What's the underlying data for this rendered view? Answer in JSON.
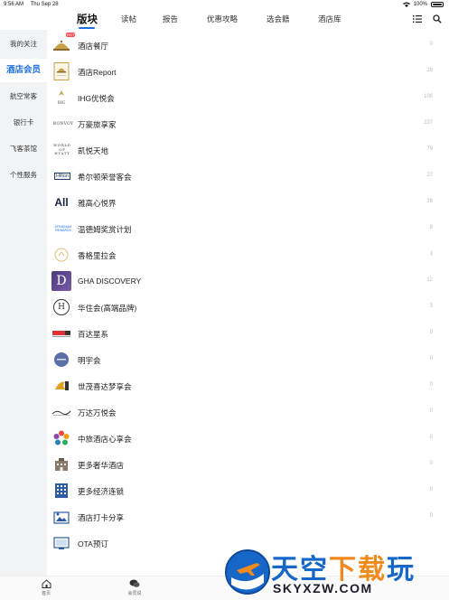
{
  "status": {
    "time": "9:56 AM",
    "date": "Thu Sep 28",
    "battery": "100%"
  },
  "nav": {
    "tabs": [
      "版块",
      "读帖",
      "报告",
      "优惠攻略",
      "选会籍",
      "酒店库"
    ],
    "active_tab": "版块"
  },
  "sidebar": {
    "items": [
      "我的关注",
      "酒店会员",
      "航空常客",
      "银行卡",
      "飞客茶馆",
      "个性服务"
    ],
    "active": "酒店会员"
  },
  "forums": [
    {
      "name": "酒店餐厅",
      "count": "0",
      "icon": "dining-cloche-icon",
      "badge": "HOT"
    },
    {
      "name": "酒店Report",
      "count": "29",
      "icon": "report-icon"
    },
    {
      "name": "IHG优悦会",
      "count": "106",
      "icon": "ihg-logo"
    },
    {
      "name": "万豪旅享家",
      "count": "237",
      "icon": "marriott-bonvoy-logo",
      "logo_text": "BONVOY"
    },
    {
      "name": "凯悦天地",
      "count": "79",
      "icon": "world-of-hyatt-logo",
      "logo_text": "WORLD OF HYATT"
    },
    {
      "name": "希尔顿荣誉客会",
      "count": "27",
      "icon": "hilton-logo",
      "logo_text": "Hilton"
    },
    {
      "name": "雅高心悦界",
      "count": "26",
      "icon": "accor-all-logo",
      "logo_text": "All"
    },
    {
      "name": "温德姆奖赏计划",
      "count": "8",
      "icon": "wyndham-rewards-logo",
      "logo_text": "WYNDHAM REWARDS"
    },
    {
      "name": "香格里拉会",
      "count": "1",
      "icon": "shangri-la-logo"
    },
    {
      "name": "GHA DISCOVERY",
      "count": "12",
      "icon": "gha-logo",
      "logo_text": "D"
    },
    {
      "name": "华住会(高端品牌)",
      "count": "3",
      "icon": "huazhu-logo",
      "logo_text": "H"
    },
    {
      "name": "百达星系",
      "count": "0",
      "icon": "bestay-logo"
    },
    {
      "name": "明宇会",
      "count": "0",
      "icon": "mingyu-logo"
    },
    {
      "name": "世茂喜达梦享会",
      "count": "0",
      "icon": "shimao-logo"
    },
    {
      "name": "万达万悦会",
      "count": "0",
      "icon": "wanda-logo"
    },
    {
      "name": "中旅酒店心享会",
      "count": "0",
      "icon": "ctg-flower-logo"
    },
    {
      "name": "更多奢华酒店",
      "count": "0",
      "icon": "luxury-hotel-icon"
    },
    {
      "name": "更多经济连锁",
      "count": "0",
      "icon": "budget-hotel-icon"
    },
    {
      "name": "酒店打卡分享",
      "count": "0",
      "icon": "checkin-share-icon"
    },
    {
      "name": "OTA预订",
      "count": "",
      "icon": "ota-booking-icon"
    }
  ],
  "bottom_tabs": [
    {
      "label": "首页",
      "icon": "home-icon"
    },
    {
      "label": "会员说",
      "icon": "chat-bubbles-icon"
    }
  ],
  "watermark": {
    "title_part1": "天空",
    "title_part2": "下载",
    "title_part3": "玩",
    "url": "SKYXZW.COM"
  },
  "colors": {
    "accent": "#1e6fe6",
    "sidebar_bg": "#f2f3f5",
    "count_text": "#bbbbbb"
  }
}
